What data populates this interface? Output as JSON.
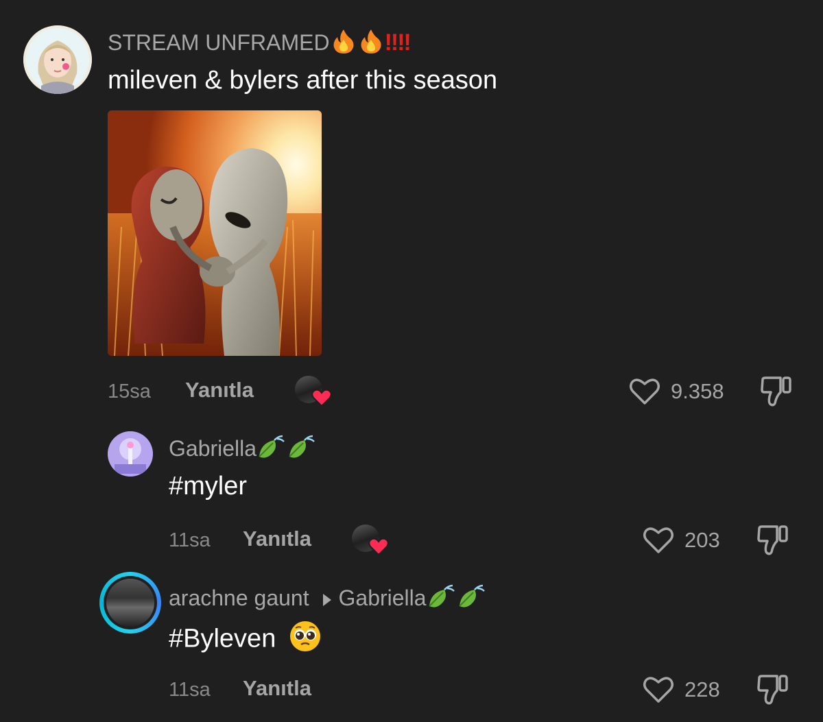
{
  "comments": [
    {
      "username": "STREAM UNFRAMED",
      "username_suffix": "!!!!",
      "text": "mileven & bylers after this season",
      "time": "15sa",
      "reply_label": "Yanıtla",
      "likes": "9.358",
      "has_image": true,
      "creator_liked": true
    },
    {
      "username": "Gabriella",
      "text": "#myler",
      "time": "11sa",
      "reply_label": "Yanıtla",
      "likes": "203",
      "creator_liked": true
    },
    {
      "username": "arachne gaunt",
      "reply_to": "Gabriella",
      "text": "#Byleven",
      "time": "11sa",
      "reply_label": "Yanıtla",
      "likes": "228",
      "creator_liked": false
    }
  ],
  "icons": {
    "fire": "fire-icon",
    "leaf": "leaf-icon",
    "like": "heart-outline-icon",
    "dislike": "thumbs-down-icon",
    "reply_arrow": "caret-right-icon",
    "pleading_face": "pleading-face-emoji",
    "creator_heart": "heart-filled-icon"
  },
  "colors": {
    "background": "#1f1f1f",
    "username": "#a8a8a8",
    "text": "#ffffff",
    "meta": "#8a8a8a",
    "creator_heart": "#fe2c55",
    "exclamation": "#e0221c",
    "ring": "#22d3ee"
  }
}
